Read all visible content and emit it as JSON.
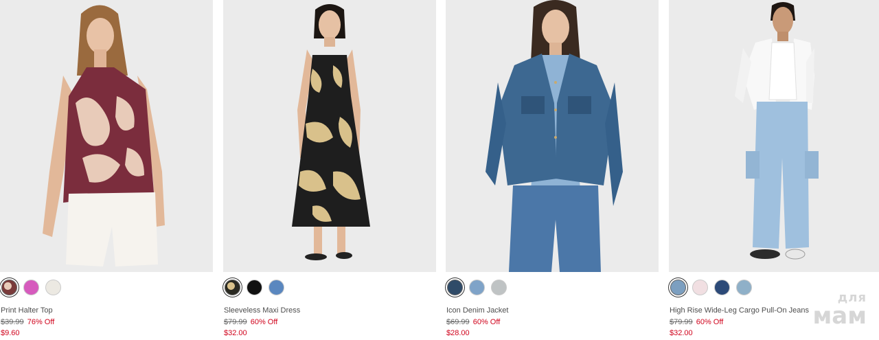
{
  "products": [
    {
      "name": "Print Halter Top",
      "original_price": "$39.99",
      "discount": "76% Off",
      "sale_price": "$9.60",
      "swatches": [
        {
          "color": "#7a3b3b",
          "pattern": true,
          "selected": true
        },
        {
          "color": "#d65bbd",
          "selected": false
        },
        {
          "color": "#ece9e2",
          "selected": false
        }
      ]
    },
    {
      "name": "Sleeveless Maxi Dress",
      "original_price": "$79.99",
      "discount": "60% Off",
      "sale_price": "$32.00",
      "swatches": [
        {
          "color": "#3a3a2e",
          "pattern": true,
          "selected": true
        },
        {
          "color": "#111111",
          "selected": false
        },
        {
          "color": "#5a87bf",
          "selected": false
        }
      ]
    },
    {
      "name": "Icon Denim Jacket",
      "original_price": "$69.99",
      "discount": "60% Off",
      "sale_price": "$28.00",
      "swatches": [
        {
          "color": "#2f4b68",
          "selected": true
        },
        {
          "color": "#7fa3c8",
          "selected": false
        },
        {
          "color": "#bfc3c4",
          "selected": false
        }
      ]
    },
    {
      "name": "High Rise Wide-Leg Cargo Pull-On Jeans",
      "original_price": "$79.99",
      "discount": "60% Off",
      "sale_price": "$32.00",
      "swatches": [
        {
          "color": "#7c9fc0",
          "selected": true
        },
        {
          "color": "#f1dfe2",
          "selected": false
        },
        {
          "color": "#2c4a78",
          "selected": false
        },
        {
          "color": "#8fb0c8",
          "selected": false
        }
      ]
    }
  ],
  "watermark": {
    "line1": "для",
    "line2": "мам"
  }
}
